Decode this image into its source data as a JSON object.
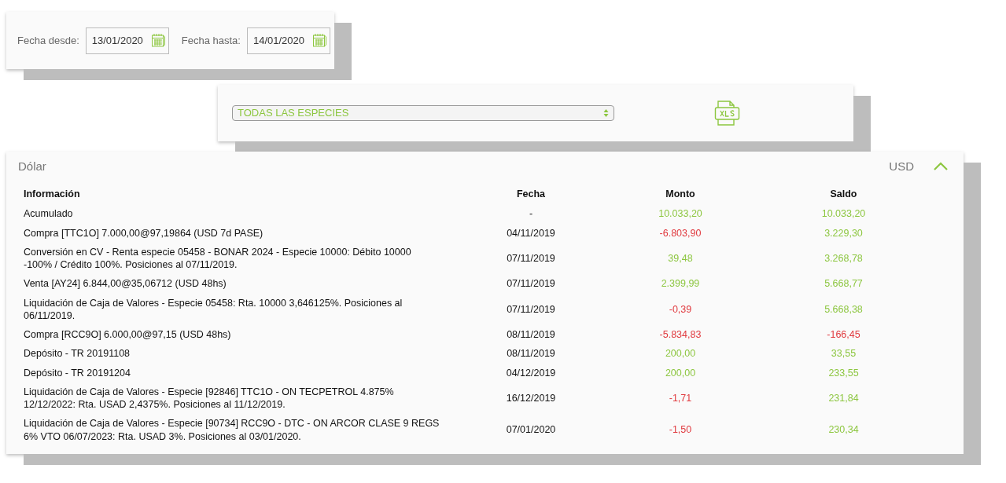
{
  "date_filter": {
    "from_label": "Fecha desde:",
    "from_value": "13/01/2020",
    "to_label": "Fecha hasta:",
    "to_value": "14/01/2020"
  },
  "species_filter": {
    "value": "TODAS LAS ESPECIES"
  },
  "account": {
    "title": "Dólar",
    "currency": "USD",
    "expanded": true,
    "table": {
      "columns": [
        "Información",
        "Fecha",
        "Monto",
        "Saldo"
      ],
      "rows": [
        {
          "info": "Acumulado",
          "fecha": "-",
          "monto": "10.033,20",
          "monto_negative": false,
          "saldo": "10.033,20",
          "saldo_negative": false
        },
        {
          "info": "Compra [TTC1O] 7.000,00@97,19864 (USD 7d PASE)",
          "fecha": "04/11/2019",
          "monto": "-6.803,90",
          "monto_negative": true,
          "saldo": "3.229,30",
          "saldo_negative": false
        },
        {
          "info": "Conversión en CV - Renta especie 05458 - BONAR 2024 - Especie 10000: Débito 10000 -100% / Crédito 100%. Posiciones al 07/11/2019.",
          "fecha": "07/11/2019",
          "monto": "39,48",
          "monto_negative": false,
          "saldo": "3.268,78",
          "saldo_negative": false
        },
        {
          "info": "Venta [AY24] 6.844,00@35,06712 (USD 48hs)",
          "fecha": "07/11/2019",
          "monto": "2.399,99",
          "monto_negative": false,
          "saldo": "5.668,77",
          "saldo_negative": false
        },
        {
          "info": "Liquidación de Caja de Valores - Especie 05458: Rta. 10000 3,646125%. Posiciones al 06/11/2019.",
          "fecha": "07/11/2019",
          "monto": "-0,39",
          "monto_negative": true,
          "saldo": "5.668,38",
          "saldo_negative": false
        },
        {
          "info": "Compra [RCC9O] 6.000,00@97,15 (USD 48hs)",
          "fecha": "08/11/2019",
          "monto": "-5.834,83",
          "monto_negative": true,
          "saldo": "-166,45",
          "saldo_negative": true
        },
        {
          "info": "Depósito - TR 20191108",
          "fecha": "08/11/2019",
          "monto": "200,00",
          "monto_negative": false,
          "saldo": "33,55",
          "saldo_negative": false
        },
        {
          "info": "Depósito - TR 20191204",
          "fecha": "04/12/2019",
          "monto": "200,00",
          "monto_negative": false,
          "saldo": "233,55",
          "saldo_negative": false
        },
        {
          "info": "Liquidación de Caja de Valores - Especie [92846] TTC1O - ON TECPETROL 4.875% 12/12/2022: Rta. USAD 2,4375%. Posiciones al 11/12/2019.",
          "fecha": "16/12/2019",
          "monto": "-1,71",
          "monto_negative": true,
          "saldo": "231,84",
          "saldo_negative": false
        },
        {
          "info": "Liquidación de Caja de Valores - Especie [90734] RCC9O - DTC - ON ARCOR CLASE 9 REGS 6% VTO 06/07/2023: Rta. USAD 3%. Posiciones al 03/01/2020.",
          "fecha": "07/01/2020",
          "monto": "-1,50",
          "monto_negative": true,
          "saldo": "230,34",
          "saldo_negative": false
        }
      ]
    }
  }
}
